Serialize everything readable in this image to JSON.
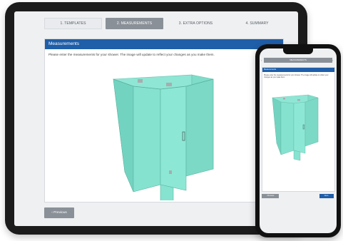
{
  "tablet": {
    "steps": [
      {
        "label": "1. TEMPLATES"
      },
      {
        "label": "2. MEASUREMENTS"
      },
      {
        "label": "3. EXTRA OPTIONS"
      },
      {
        "label": "4. SUMMARY"
      }
    ],
    "active_step": 1,
    "panel": {
      "title": "Measurements",
      "instructions": "Please enter the measurements for your shower. The image will update to reflect your changes as you make them."
    },
    "previous_label": "‹  Previous"
  },
  "phone": {
    "step_label": "MEASUREMENTS",
    "panel": {
      "title": "Measurements",
      "instructions": "Please enter the measurements for your shower. The image will update to reflect your changes as you make them."
    },
    "previous_label": "‹ Previous",
    "next_label": "Next ›"
  },
  "colors": {
    "accent_blue": "#1f5ea8",
    "step_active": "#8a9097",
    "glass": "#7fe0cc",
    "device_frame": "#1c1c1c"
  }
}
